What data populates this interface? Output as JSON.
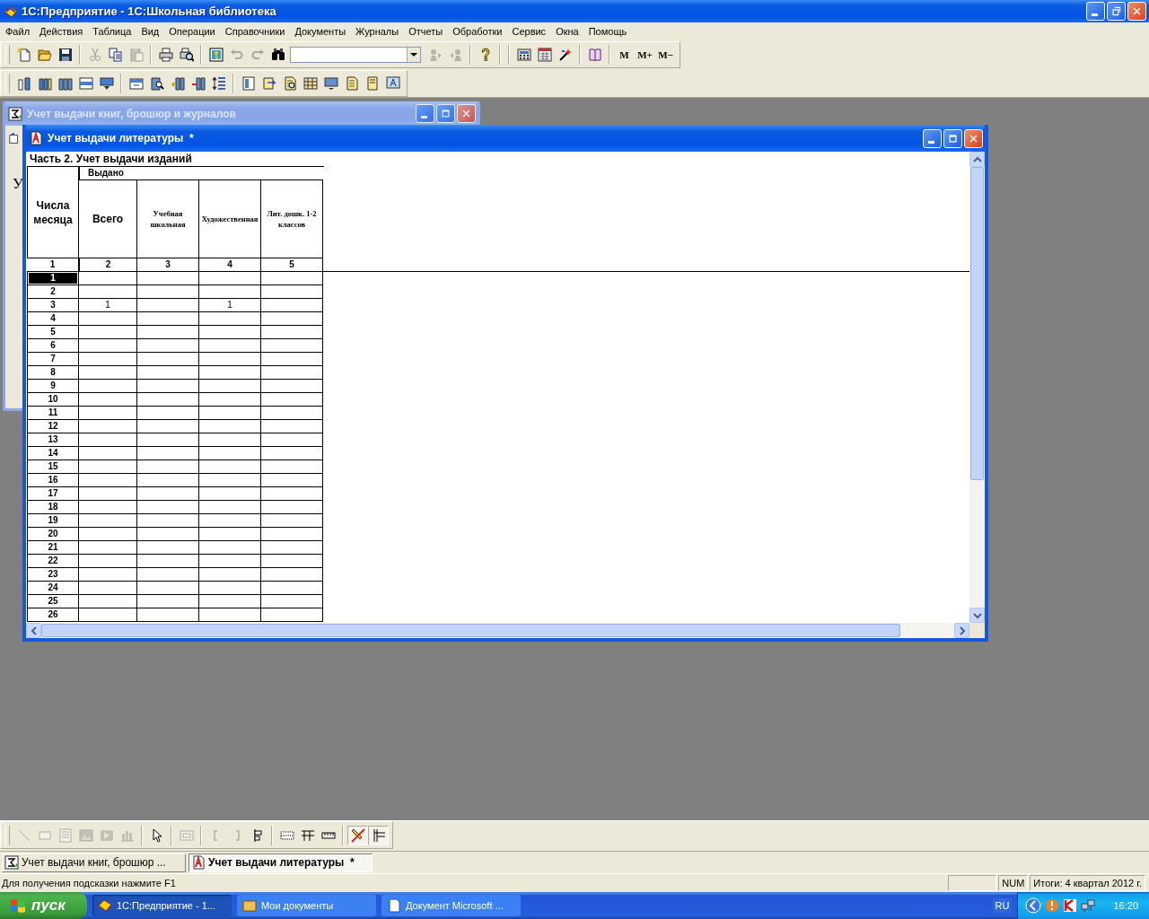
{
  "app": {
    "title": "1С:Предприятие - 1С:Школьная библиотека",
    "active": true
  },
  "menu": [
    "Файл",
    "Действия",
    "Таблица",
    "Вид",
    "Операции",
    "Справочники",
    "Документы",
    "Журналы",
    "Отчеты",
    "Обработки",
    "Сервис",
    "Окна",
    "Помощь"
  ],
  "toolbar_1": {
    "buttons": [
      {
        "disabled": false
      },
      {
        "disabled": false
      },
      {
        "disabled": false
      },
      {
        "disabled": true
      },
      {
        "disabled": false
      },
      {
        "disabled": true
      },
      {
        "disabled": false
      },
      {
        "disabled": false
      },
      {
        "disabled": false
      },
      {
        "disabled": true
      },
      {
        "disabled": true
      },
      {
        "disabled": false
      },
      {
        "disabled": true
      },
      {
        "disabled": true
      },
      {
        "disabled": false
      },
      {
        "disabled": false
      },
      {
        "disabled": false
      },
      {
        "disabled": false
      },
      {
        "disabled": false
      }
    ],
    "memory_buttons": [
      "M",
      "M+",
      "M−"
    ]
  },
  "back_window": {
    "title": "Учет выдачи книг, брошюр и журналов",
    "active": false,
    "visible_text": "У"
  },
  "report_window": {
    "title": "Учет выдачи литературы  *",
    "active": true,
    "heading": "Часть 2. Учет выдачи изданий",
    "group_header": "Выдано",
    "columns": [
      {
        "label": "Числа месяца",
        "number": "1",
        "kind": "large"
      },
      {
        "label": "Всего",
        "number": "2",
        "kind": "large"
      },
      {
        "label": "Учебная школьная",
        "number": "3",
        "kind": "small"
      },
      {
        "label": "Художественная",
        "number": "4",
        "kind": "small"
      },
      {
        "label": "Лит. дошк. 1-2 классов",
        "number": "5",
        "kind": "small"
      }
    ],
    "rows": [
      {
        "day": "1",
        "selected": true
      },
      {
        "day": "2",
        "selected": false
      },
      {
        "day": "3",
        "selected": false,
        "total": "1",
        "fiction": "1"
      },
      {
        "day": "4",
        "selected": false
      },
      {
        "day": "5",
        "selected": false
      },
      {
        "day": "6",
        "selected": false
      },
      {
        "day": "7",
        "selected": false
      },
      {
        "day": "8",
        "selected": false
      },
      {
        "day": "9",
        "selected": false
      },
      {
        "day": "10",
        "selected": false
      },
      {
        "day": "11",
        "selected": false
      },
      {
        "day": "12",
        "selected": false
      },
      {
        "day": "13",
        "selected": false
      },
      {
        "day": "14",
        "selected": false
      },
      {
        "day": "15",
        "selected": false
      },
      {
        "day": "16",
        "selected": false
      },
      {
        "day": "17",
        "selected": false
      },
      {
        "day": "18",
        "selected": false
      },
      {
        "day": "19",
        "selected": false
      },
      {
        "day": "20",
        "selected": false
      },
      {
        "day": "21",
        "selected": false
      },
      {
        "day": "22",
        "selected": false
      },
      {
        "day": "23",
        "selected": false
      },
      {
        "day": "24",
        "selected": false
      },
      {
        "day": "25",
        "selected": false
      },
      {
        "day": "26",
        "selected": false
      }
    ]
  },
  "bottom_toolbar": [
    {
      "disabled": true,
      "pressed": false
    },
    {
      "disabled": true,
      "pressed": false
    },
    {
      "disabled": true,
      "pressed": false
    },
    {
      "disabled": true,
      "pressed": false
    },
    {
      "disabled": true,
      "pressed": false
    },
    {
      "disabled": true,
      "pressed": false
    },
    {
      "disabled": false,
      "pressed": false
    },
    {
      "disabled": true,
      "pressed": false
    },
    {
      "disabled": true,
      "pressed": false
    },
    {
      "disabled": true,
      "pressed": false
    },
    {
      "disabled": false,
      "pressed": false
    },
    {
      "disabled": false,
      "pressed": false
    },
    {
      "disabled": false,
      "pressed": false
    },
    {
      "disabled": false,
      "pressed": false
    },
    {
      "disabled": false,
      "pressed": true
    },
    {
      "disabled": false,
      "pressed": true
    }
  ],
  "window_tabs": [
    {
      "title": "Учет выдачи книг, брошюр ...",
      "selected": false
    },
    {
      "title": "Учет выдачи литературы  *",
      "selected": true
    }
  ],
  "status_bar": {
    "hint": "Для получения подсказки нажмите F1",
    "panels": [
      "NUM",
      "Итоги: 4 квартал 2012 г."
    ]
  },
  "taskbar": {
    "start": "пуск",
    "tasks": [
      {
        "label": "1С:Предприятие - 1...",
        "selected": true
      },
      {
        "label": "Мои документы",
        "selected": false
      },
      {
        "label": "Документ Microsoft ...",
        "selected": false
      }
    ],
    "language": "RU",
    "clock": "16:20"
  }
}
